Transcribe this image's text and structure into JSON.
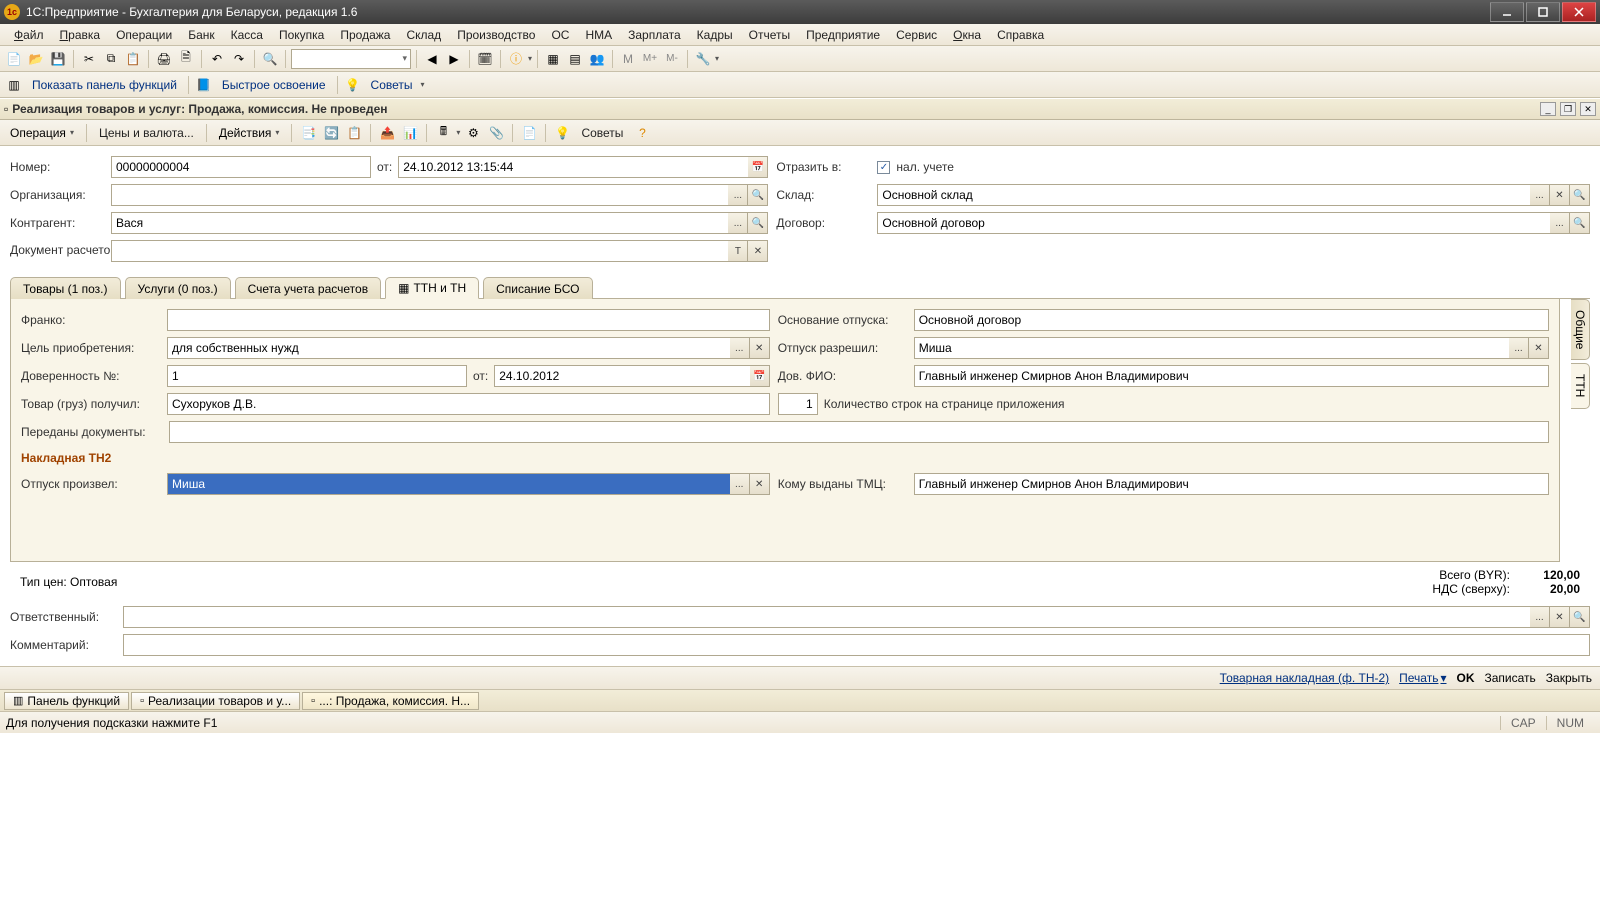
{
  "titlebar": "1С:Предприятие - Бухгалтерия для Беларуси, редакция 1.6",
  "menu": [
    "Файл",
    "Правка",
    "Операции",
    "Банк",
    "Касса",
    "Покупка",
    "Продажа",
    "Склад",
    "Производство",
    "ОС",
    "НМА",
    "Зарплата",
    "Кадры",
    "Отчеты",
    "Предприятие",
    "Сервис",
    "Окна",
    "Справка"
  ],
  "toolbar2": {
    "panel": "Показать панель функций",
    "quick": "Быстрое освоение",
    "tips": "Советы"
  },
  "doc": {
    "title": "Реализация товаров и услуг: Продажа, комиссия. Не проведен",
    "menus": {
      "op": "Операция",
      "prices": "Цены и валюта...",
      "actions": "Действия",
      "tips": "Советы"
    }
  },
  "header": {
    "number_lbl": "Номер:",
    "number": "00000000004",
    "from_lbl": "от:",
    "from": "24.10.2012 13:15:44",
    "reflect_lbl": "Отразить в:",
    "reflect_chk": "нал. учете",
    "org_lbl": "Организация:",
    "org": "",
    "sklad_lbl": "Склад:",
    "sklad": "Основной склад",
    "counter_lbl": "Контрагент:",
    "counter": "Вася",
    "contract_lbl": "Договор:",
    "contract": "Основной договор",
    "docras_lbl": "Документ расчетов:",
    "docras": ""
  },
  "tabs": [
    "Товары (1 поз.)",
    "Услуги (0 поз.)",
    "Счета учета расчетов",
    "ТТН и ТН",
    "Списание БСО"
  ],
  "vtabs": [
    "Общие",
    "ТТН"
  ],
  "panel": {
    "franko_lbl": "Франко:",
    "franko": "",
    "osn_lbl": "Основание отпуска:",
    "osn": "Основной договор",
    "cel_lbl": "Цель приобретения:",
    "cel": "для собственных нужд",
    "perm_lbl": "Отпуск разрешил:",
    "perm": "Миша",
    "dov_lbl": "Доверенность №:",
    "dov": "1",
    "dov_from_lbl": "от:",
    "dov_from": "24.10.2012",
    "dovfio_lbl": "Дов. ФИО:",
    "dovfio": "Главный инженер Смирнов Анон Владимирович",
    "goods_lbl": "Товар (груз) получил:",
    "goods": "Сухоруков Д.В.",
    "pages_val": "1",
    "pages_lbl": "Количество строк на странице приложения",
    "docs_lbl": "Переданы документы:",
    "docs": "",
    "section": "Накладная ТН2",
    "issued_lbl": "Отпуск произвел:",
    "issued": "Миша",
    "tmc_lbl": "Кому выданы ТМЦ:",
    "tmc": "Главный инженер Смирнов Анон Владимирович"
  },
  "totals": {
    "price_type": "Тип цен: Оптовая",
    "total_lbl": "Всего (BYR):",
    "total": "120,00",
    "vat_lbl": "НДС (сверху):",
    "vat": "20,00"
  },
  "footer_form": {
    "resp_lbl": "Ответственный:",
    "resp": "",
    "comment_lbl": "Комментарий:",
    "comment": ""
  },
  "footer_btns": {
    "print_doc": "Товарная накладная (ф. ТН-2)",
    "print": "Печать",
    "ok": "OK",
    "write": "Записать",
    "close": "Закрыть"
  },
  "tasks": [
    "Панель функций",
    "Реализации товаров и у...",
    "...: Продажа, комиссия. Н..."
  ],
  "status": {
    "hint": "Для получения подсказки нажмите F1",
    "cap": "CAP",
    "num": "NUM"
  }
}
